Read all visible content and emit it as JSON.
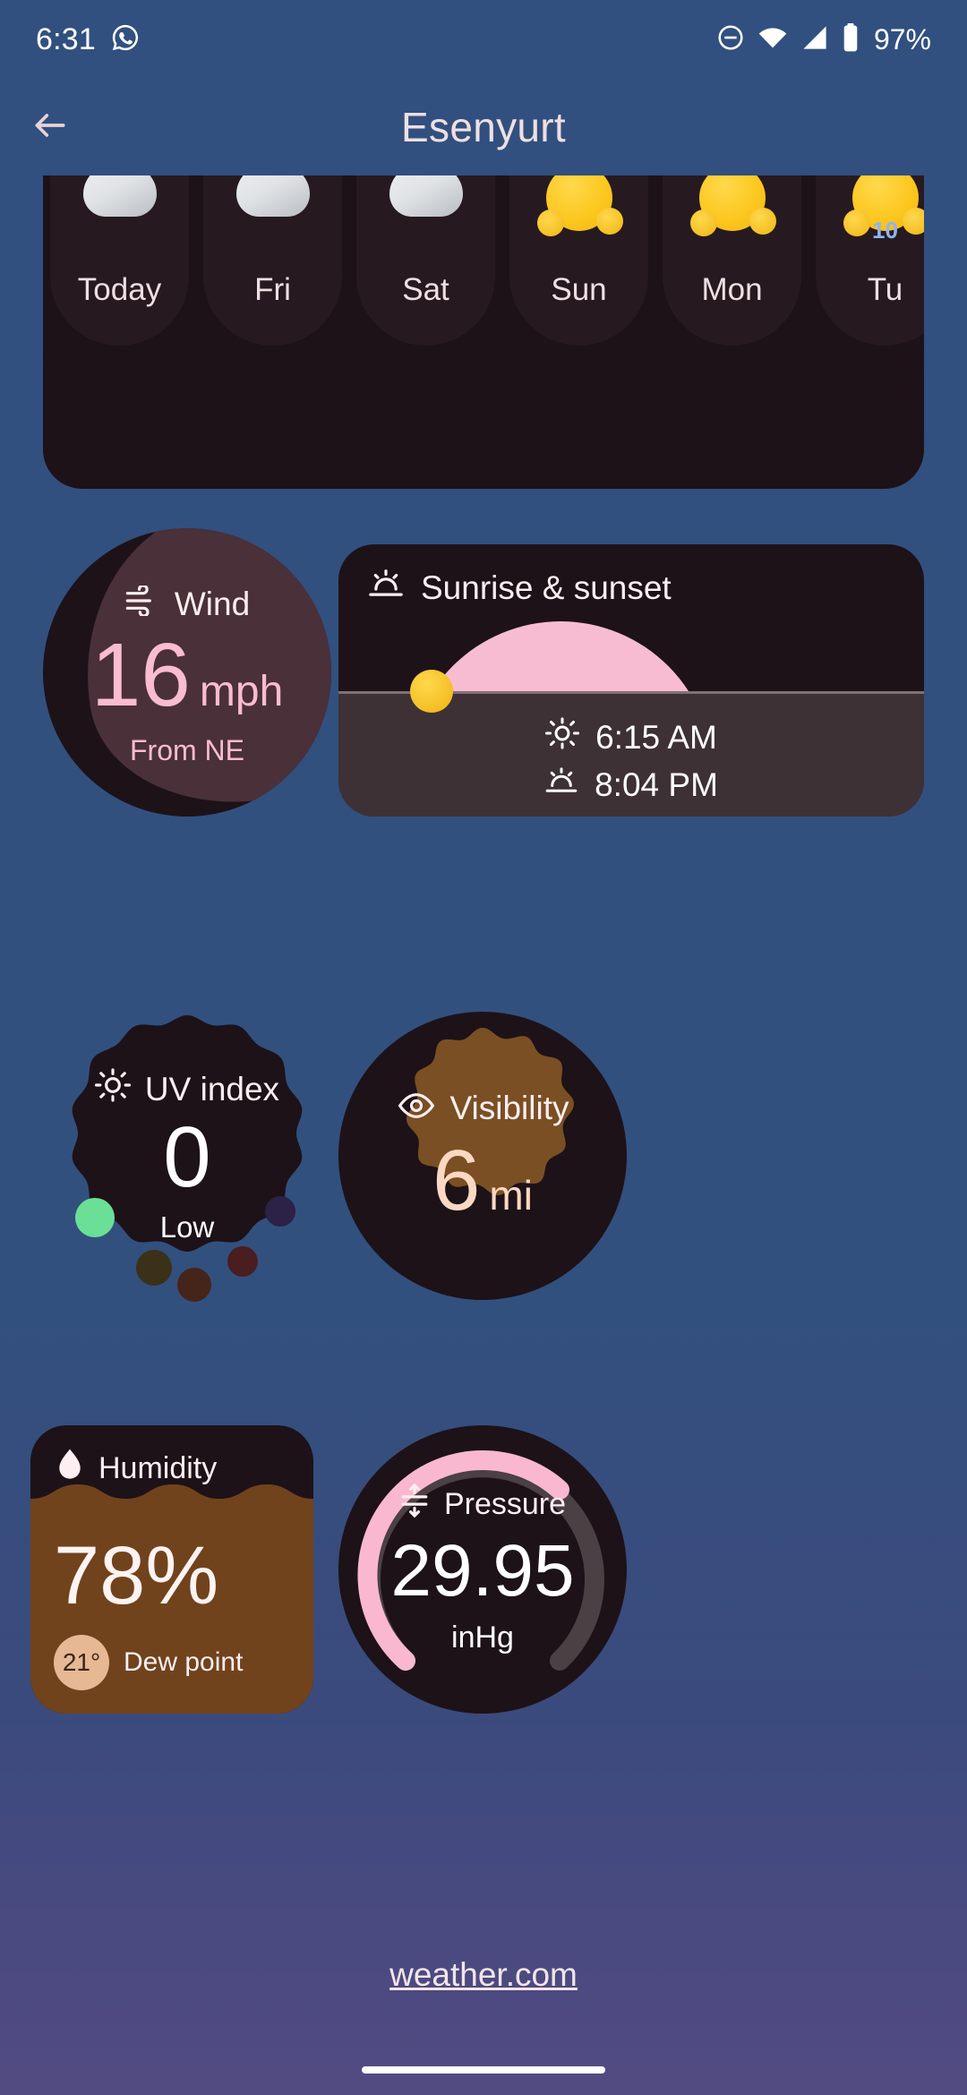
{
  "status_bar": {
    "time": "6:31",
    "battery_percent": "97%",
    "icons": [
      "whatsapp-icon",
      "do-not-disturb-icon",
      "wifi-icon",
      "cellular-signal-icon",
      "battery-icon"
    ]
  },
  "app_bar": {
    "back_label": "back-arrow",
    "title": "Esenyurt"
  },
  "forecast": {
    "days": [
      {
        "label": "Today",
        "icon": "cloud-icon",
        "sub": ""
      },
      {
        "label": "Fri",
        "icon": "cloud-icon",
        "sub": ""
      },
      {
        "label": "Sat",
        "icon": "cloud-icon",
        "sub": ""
      },
      {
        "label": "Sun",
        "icon": "sun-icon",
        "sub": ""
      },
      {
        "label": "Mon",
        "icon": "sun-icon",
        "sub": ""
      },
      {
        "label": "Tu",
        "icon": "sun-icon",
        "sub": "10"
      }
    ]
  },
  "wind": {
    "icon": "wind-icon",
    "title": "Wind",
    "value": "16",
    "unit": "mph",
    "direction": "From NE",
    "accent": "#f9bcd0"
  },
  "sunrise_sunset": {
    "icon": "sunrise-icon",
    "title": "Sunrise & sunset",
    "sunrise_icon": "sun-icon",
    "sunrise": "6:15 AM",
    "sunset_icon": "sunset-icon",
    "sunset": "8:04 PM",
    "arc_color": "#f7bcd1"
  },
  "uv_index": {
    "icon": "sun-uv-icon",
    "title": "UV index",
    "value": "0",
    "level": "Low",
    "active_dot_color": "#6bdf96"
  },
  "visibility": {
    "icon": "eye-icon",
    "title": "Visibility",
    "value": "6",
    "unit": "mi",
    "accent": "#fbd8c2",
    "fill_color": "#7a4f24"
  },
  "humidity": {
    "icon": "water-drop-icon",
    "title": "Humidity",
    "value": "78%",
    "dew_point_value": "21°",
    "dew_point_label": "Dew point",
    "fill_color": "#70431d"
  },
  "pressure": {
    "icon": "pressure-icon",
    "title": "Pressure",
    "value": "29.95",
    "unit": "inHg",
    "arc_color": "#f9b8cf"
  },
  "footer": {
    "link_text": "weather.com"
  }
}
